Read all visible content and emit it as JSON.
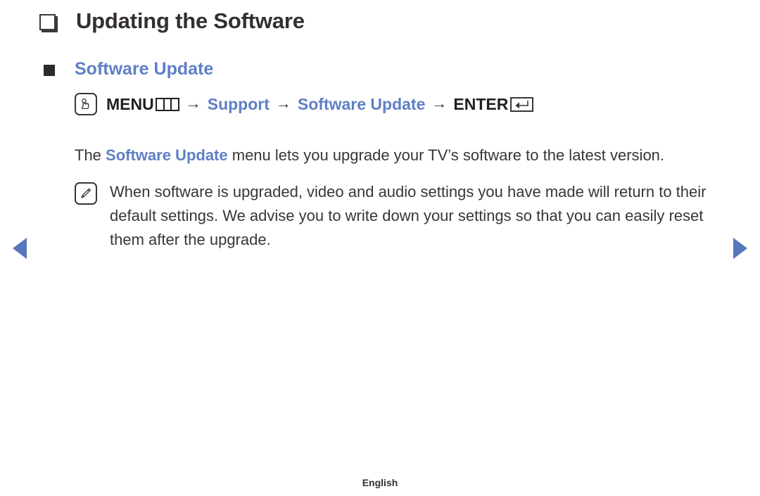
{
  "page": {
    "title": "Updating the Software",
    "title_bullet_icon": "hollow-square-bullet-icon",
    "footer_language": "English"
  },
  "section": {
    "bullet_icon": "filled-square-bullet-icon",
    "heading": "Software Update"
  },
  "nav_path": {
    "hand_icon": "pointing-hand-icon",
    "menu_label": "MENU",
    "menu_glyph_icon": "menu-bars-box-icon",
    "arrow": "→",
    "step_support": "Support",
    "step_software_update": "Software Update",
    "enter_label": "ENTER",
    "enter_glyph_icon": "enter-return-arrow-icon"
  },
  "body": {
    "lead": "The ",
    "highlight": "Software Update",
    "tail": " menu lets you upgrade your TV’s software to the latest version."
  },
  "note": {
    "icon": "note-pencil-icon",
    "text": "When software is upgraded, video and audio settings you have made will return to their default settings. We advise you to write down your settings so that you can easily reset them after the upgrade."
  },
  "pager": {
    "prev_icon": "triangle-left-icon",
    "next_icon": "triangle-right-icon"
  },
  "colors": {
    "accent_blue": "#5f7fc5",
    "arrow_blue": "#5678bd",
    "text_dark": "#3a3537"
  }
}
